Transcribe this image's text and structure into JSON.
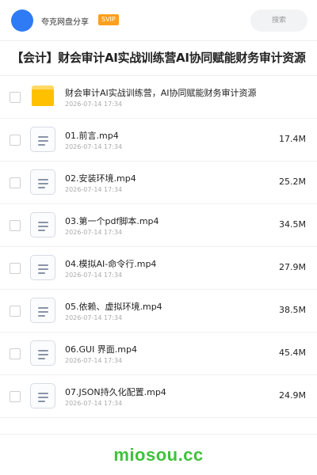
{
  "header": {
    "user_name": "夸克网盘分享",
    "badge": "SVIP",
    "search_placeholder": "搜索"
  },
  "title": "【会计】财会审计AI实战训练营AI协同赋能财务审计资源",
  "files": [
    {
      "type": "folder",
      "name": "财会审计AI实战训练营，AI协同赋能财务审计资源",
      "date": "2026-07-14 17:34",
      "size": ""
    },
    {
      "type": "file",
      "name": "01.前言.mp4",
      "date": "2026-07-14 17:34",
      "size": "17.4M"
    },
    {
      "type": "file",
      "name": "02.安装环境.mp4",
      "date": "2026-07-14 17:34",
      "size": "25.2M"
    },
    {
      "type": "file",
      "name": "03.第一个pdf脚本.mp4",
      "date": "2026-07-14 17:34",
      "size": "34.5M"
    },
    {
      "type": "file",
      "name": "04.模拟AI-命令行.mp4",
      "date": "2026-07-14 17:34",
      "size": "27.9M"
    },
    {
      "type": "file",
      "name": "05.依赖、虚拟环境.mp4",
      "date": "2026-07-14 17:34",
      "size": "38.5M"
    },
    {
      "type": "file",
      "name": "06.GUI 界面.mp4",
      "date": "2026-07-14 17:34",
      "size": "45.4M"
    },
    {
      "type": "file",
      "name": "07.JSON持久化配置.mp4",
      "date": "2026-07-14 17:34",
      "size": "24.9M"
    }
  ],
  "watermark": "miosou.cc",
  "colors": {
    "avatar": "#2f7bf5",
    "badge": "#ff9f1c",
    "folder": "#ffc000",
    "watermark": "#3ec23a"
  }
}
